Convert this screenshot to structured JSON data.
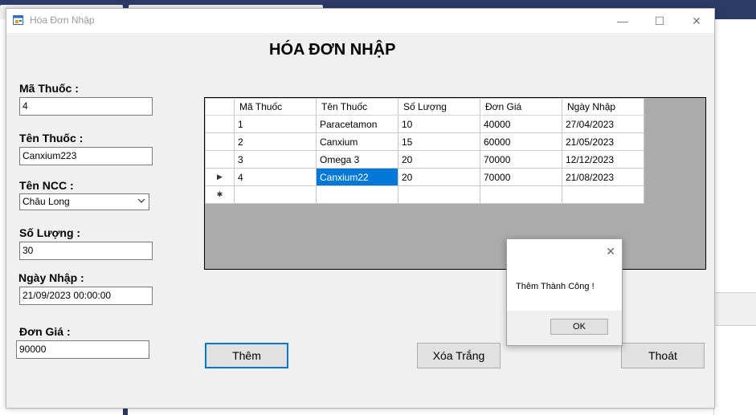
{
  "window": {
    "title": "Hóa Đơn Nhập",
    "minimize_glyph": "—",
    "maximize_glyph": "☐",
    "close_glyph": "✕"
  },
  "form": {
    "heading": "HÓA ĐƠN NHẬP",
    "ma_thuoc": {
      "label": "Mã Thuốc :",
      "value": "4"
    },
    "ten_thuoc": {
      "label": "Tên Thuốc :",
      "value": "Canxium223"
    },
    "ten_ncc": {
      "label": "Tên NCC :",
      "value": "Châu Long"
    },
    "so_luong": {
      "label": "Số Lượng :",
      "value": "30"
    },
    "ngay_nhap": {
      "label": "Ngày Nhập :",
      "value": "21/09/2023 00:00:00"
    },
    "don_gia": {
      "label": "Đơn Giá :",
      "value": "90000"
    }
  },
  "grid": {
    "columns": [
      "Mã Thuốc",
      "Tên Thuốc",
      "Số Lượng",
      "Đơn Giá",
      "Ngày Nhập"
    ],
    "rows": [
      [
        "1",
        "Paracetamon",
        "10",
        "40000",
        "27/04/2023"
      ],
      [
        "2",
        "Canxium",
        "15",
        "60000",
        "21/05/2023"
      ],
      [
        "3",
        "Omega 3",
        "20",
        "70000",
        "12/12/2023"
      ],
      [
        "4",
        "Canxium22",
        "20",
        "70000",
        "21/08/2023"
      ]
    ],
    "current_row_marker": "▶",
    "new_row_marker": "✱"
  },
  "buttons": {
    "them": "Thêm",
    "xoa_trang": "Xóa Trắng",
    "thoat": "Thoát"
  },
  "messagebox": {
    "message": "Thêm Thành Công !",
    "ok": "OK",
    "close_glyph": "✕"
  },
  "colors": {
    "selection": "#0078d7",
    "grid_background": "#ababab",
    "window_background": "#f0f0f0"
  }
}
